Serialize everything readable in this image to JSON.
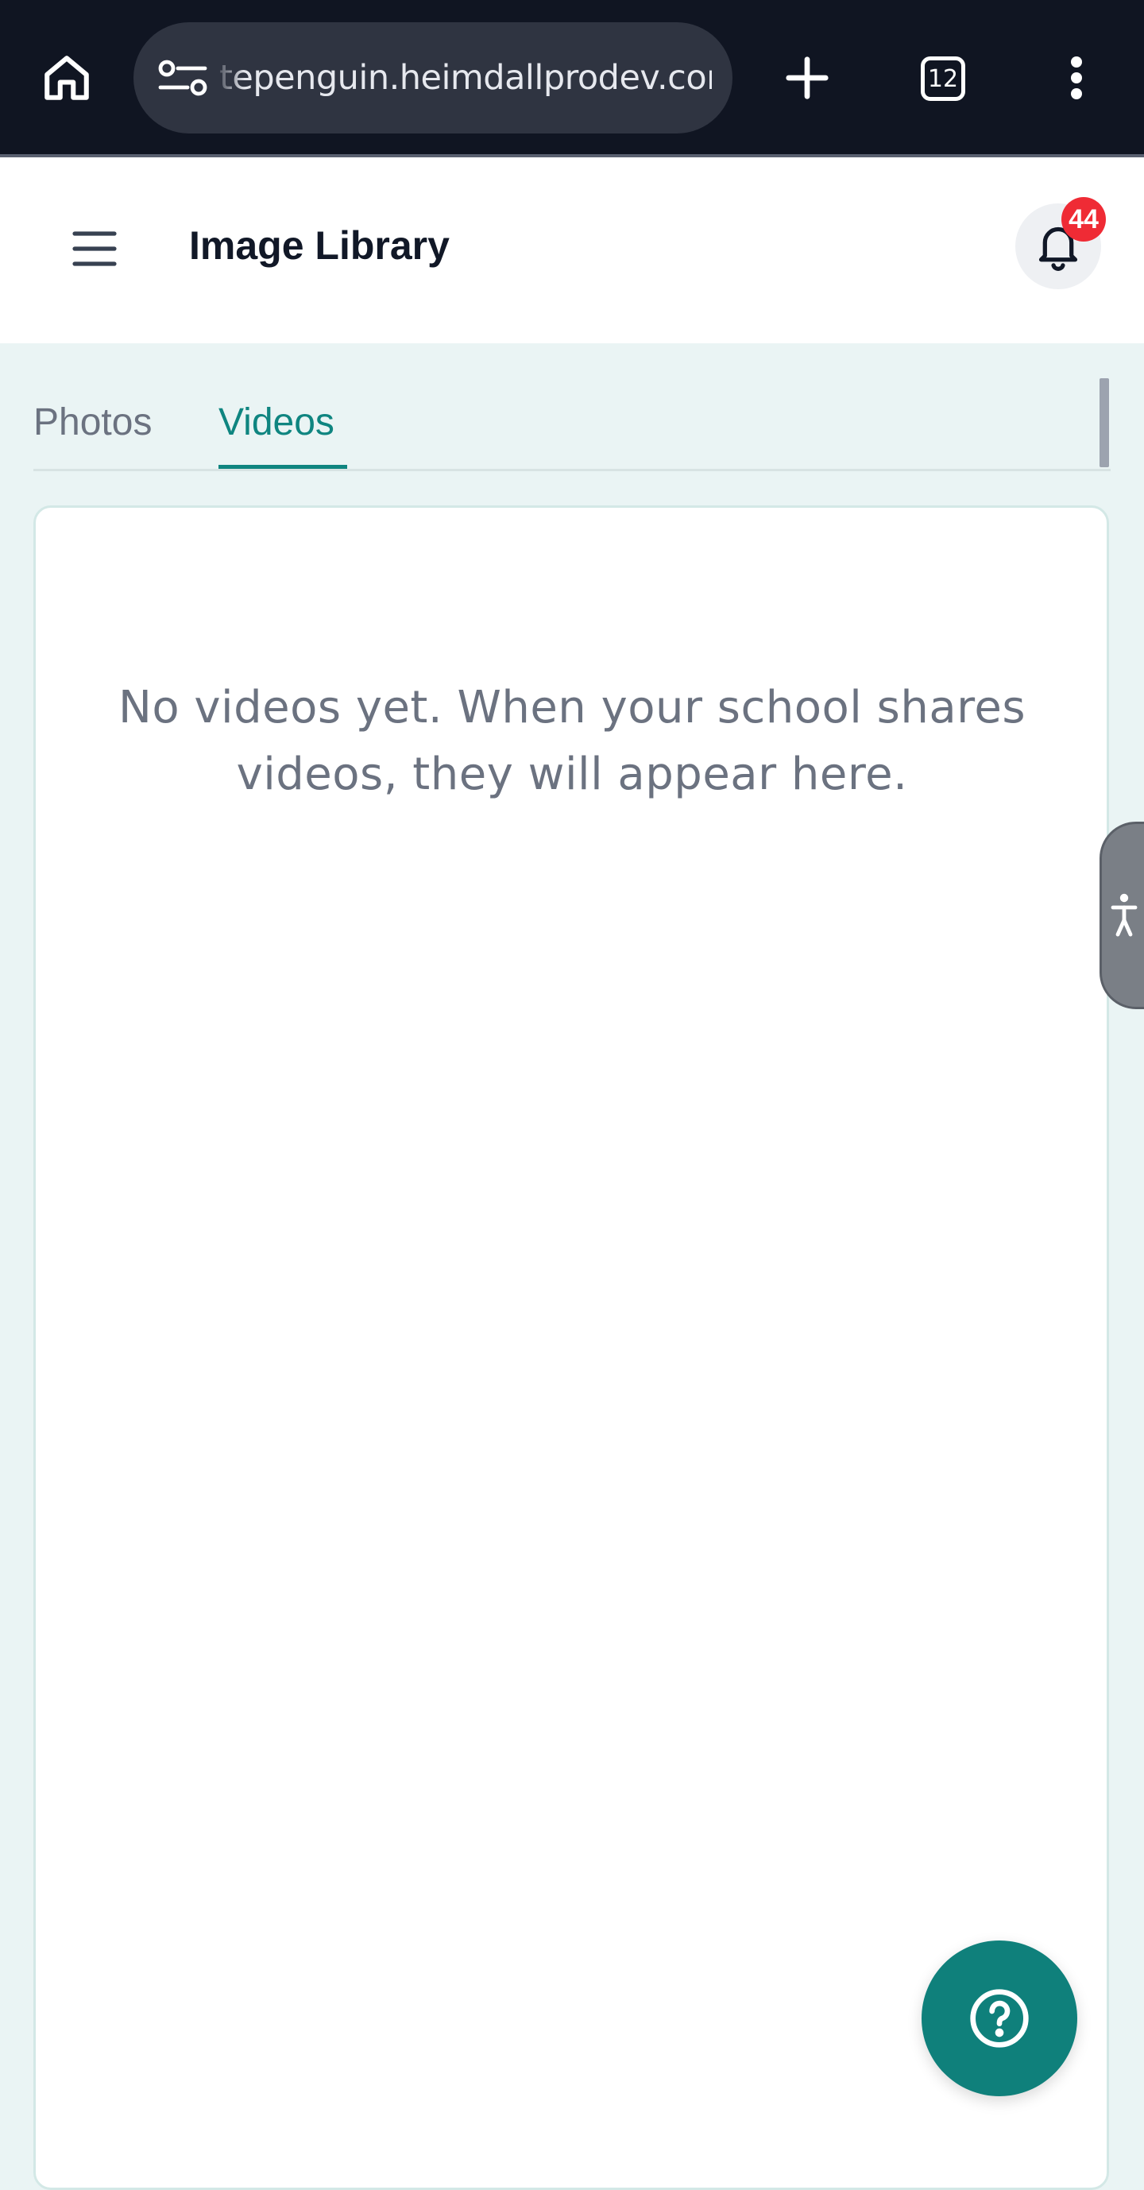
{
  "browser": {
    "url": "tepenguin.heimdallprodev.com",
    "tab_count": "12"
  },
  "header": {
    "title": "Image Library",
    "notification_count": "44"
  },
  "tabs": [
    {
      "label": "Photos",
      "active": false
    },
    {
      "label": "Videos",
      "active": true
    }
  ],
  "main": {
    "empty_message": "No videos yet. When your school shares videos, they will appear here."
  },
  "colors": {
    "accent": "#0f8580",
    "badge": "#ef2b35",
    "page_background": "#eaf4f4"
  },
  "icons": [
    "home-icon",
    "site-settings-icon",
    "plus-icon",
    "tab-switcher-icon",
    "more-vert-icon",
    "hamburger-icon",
    "bell-icon",
    "accessibility-icon",
    "help-icon"
  ]
}
